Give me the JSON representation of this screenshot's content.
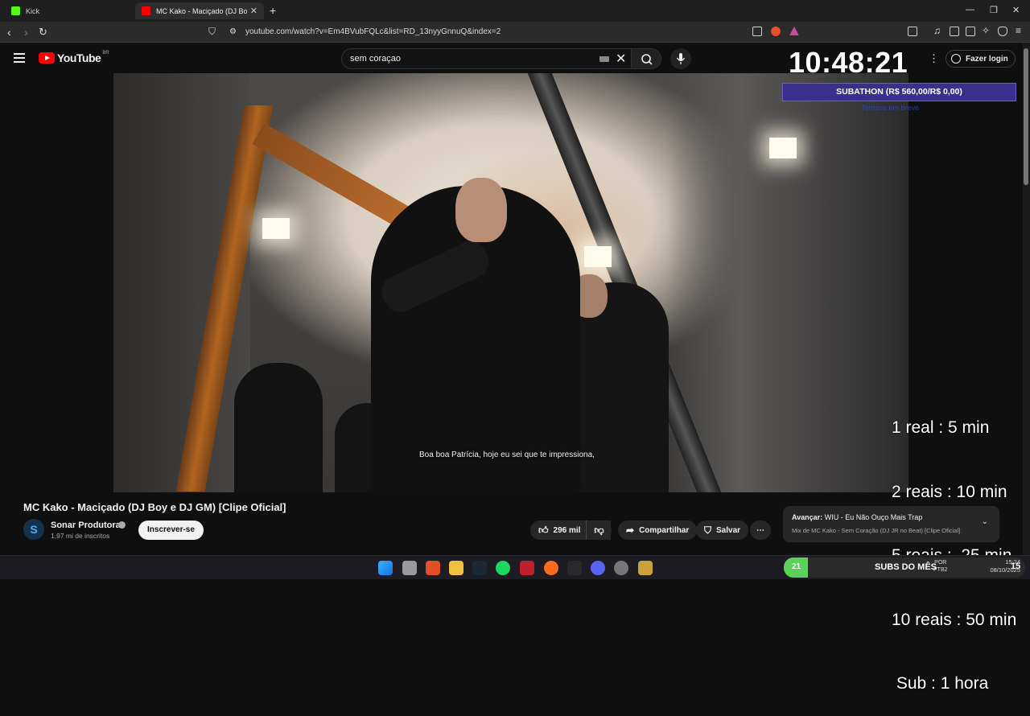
{
  "browser": {
    "tabs": [
      {
        "label": "Kick",
        "favicon_color": "#53fc18"
      },
      {
        "label": "MC Kako - Maciçado (DJ Boy",
        "favicon_color": "#ff0000"
      }
    ],
    "url": "youtube.com/watch?v=Em4BVubFQLc&list=RD_13nyyGnnuQ&index=2"
  },
  "youtube": {
    "logo_text": "YouTube",
    "logo_country": "BR",
    "search_value": "sem coraçao",
    "login_label": "Fazer login"
  },
  "overlay": {
    "clock": "10:48:21",
    "subathon": "SUBATHON (R$ 560,00/R$ 0,00)",
    "subathon_sub": "Termina em breve",
    "rates": [
      "1 real : 5 min",
      "2 reais : 10 min",
      "5 reais :  25 min",
      "10 reais : 50 min",
      " Sub : 1 hora"
    ]
  },
  "video": {
    "subtitle": "Boa boa Patrícia, hoje eu sei que te impressiona,",
    "title": "MC Kako - Maciçado (DJ Boy e DJ GM) [Clipe Oficial]",
    "channel": "Sonar Produtora",
    "channel_initial": "S",
    "subscribers": "1,97 mi de inscritos",
    "subscribe_label": "Inscrever-se",
    "likes": "296 mil",
    "share_label": "Compartilhar",
    "save_label": "Salvar"
  },
  "next": {
    "prefix": "Avançar:",
    "title": "WIU - Eu Não Ouço Mais Trap",
    "mix": "Mix de MC Kako - Sem Coração (DJ JR no Beat) [Clipe Oficial]"
  },
  "taskbar": {
    "subs_count": "21",
    "subs_label": "SUBS DO MÊS",
    "subs_progress": 0.1,
    "lang_1": "POR",
    "lang_2": "PTB2",
    "time": "15:24",
    "date": "08/10/2025",
    "notifications": "15"
  },
  "colors": {
    "youtube_red": "#ff0000",
    "subathon_bg": "#3a2f8a",
    "subs_green": "#5ad25a"
  }
}
